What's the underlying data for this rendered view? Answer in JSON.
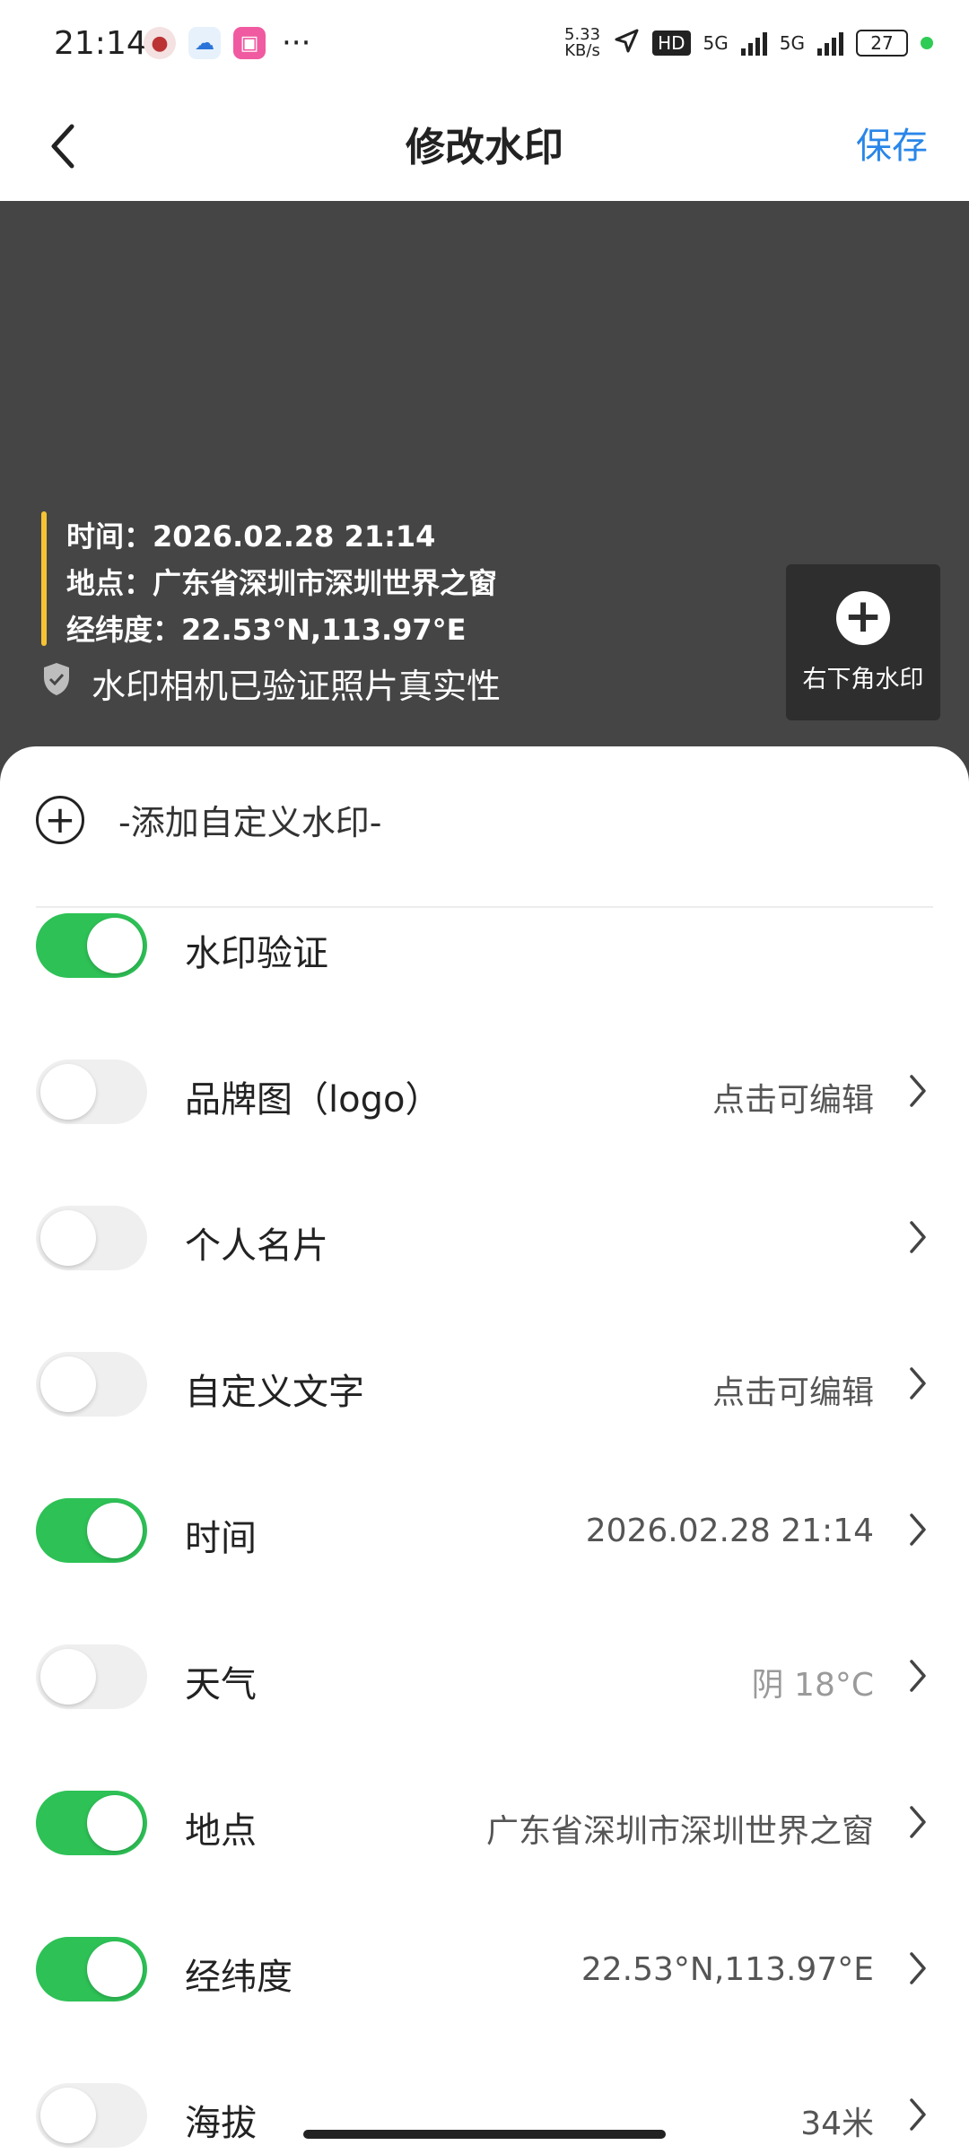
{
  "status_bar": {
    "time": "21:14",
    "network_speed_top": "5.33",
    "network_speed_bottom": "KB/s",
    "hd_label": "HD",
    "net1": "5G",
    "net2": "5G",
    "battery": "27",
    "more": "···"
  },
  "header": {
    "title": "修改水印",
    "save_label": "保存"
  },
  "preview": {
    "lines": [
      "时间：2026.02.28 21:14",
      "地点：广东省深圳市深圳世界之窗",
      "经纬度：22.53°N,113.97°E"
    ],
    "verify_text": "水印相机已验证照片真实性",
    "corner_button_label": "右下角水印"
  },
  "add_custom": {
    "label": "-添加自定义水印-"
  },
  "items": [
    {
      "label": "水印验证",
      "value": "",
      "on": true,
      "chevron": false
    },
    {
      "label": "品牌图（logo）",
      "value": "点击可编辑",
      "on": false,
      "chevron": true
    },
    {
      "label": "个人名片",
      "value": "",
      "on": false,
      "chevron": true
    },
    {
      "label": "自定义文字",
      "value": "点击可编辑",
      "on": false,
      "chevron": true
    },
    {
      "label": "时间",
      "value": "2026.02.28 21:14",
      "on": true,
      "chevron": true
    },
    {
      "label": "天气",
      "value": "阴 18°C",
      "on": false,
      "chevron": true
    },
    {
      "label": "地点",
      "value": "广东省深圳市深圳世界之窗",
      "on": true,
      "chevron": true
    },
    {
      "label": "经纬度",
      "value": "22.53°N,113.97°E",
      "on": true,
      "chevron": true
    },
    {
      "label": "海拔",
      "value": "34米",
      "on": false,
      "chevron": true
    }
  ]
}
